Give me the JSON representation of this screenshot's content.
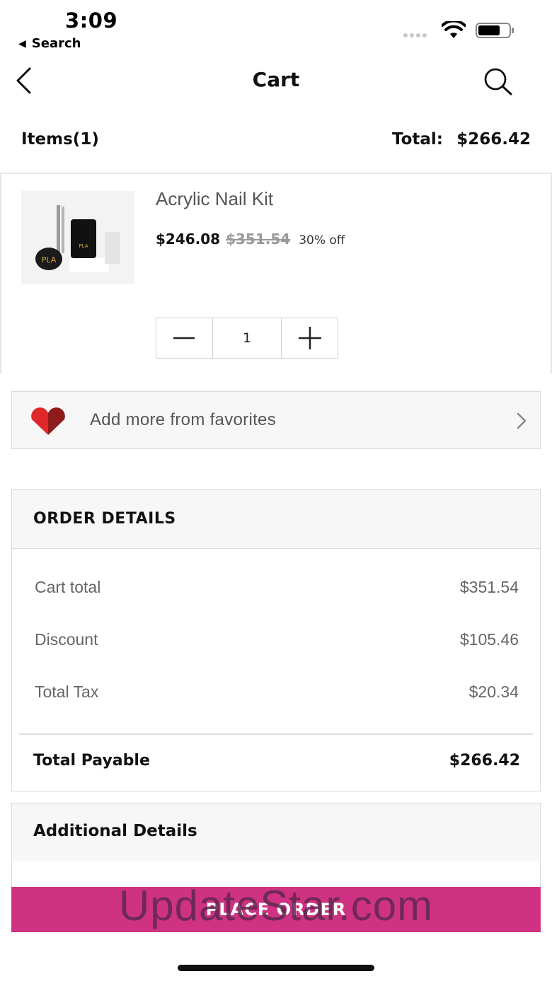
{
  "status_bar": {
    "time": "3:09",
    "back_app": "Search",
    "icons": [
      "signal-dots-icon",
      "wifi-icon",
      "battery-icon"
    ]
  },
  "nav": {
    "title": "Cart",
    "back_icon": "chevron-left-icon",
    "search_icon": "search-icon"
  },
  "summary": {
    "items_label": "Items(1)",
    "total_label": "Total:",
    "total_value": "$266.42"
  },
  "cart_items": [
    {
      "name": "Acrylic Nail Kit",
      "price": "$246.08",
      "original_price": "$351.54",
      "discount": "30% off",
      "quantity": "1",
      "image_text": "PLA"
    }
  ],
  "favorites": {
    "label": "Add more from favorites",
    "icon": "heart-icon",
    "chevron": "chevron-right-icon"
  },
  "order_details": {
    "title": "ORDER DETAILS",
    "rows": [
      {
        "label": "Cart total",
        "value": "$351.54"
      },
      {
        "label": "Discount",
        "value": "$105.46"
      },
      {
        "label": "Total Tax",
        "value": "$20.34"
      }
    ],
    "total_label": "Total Payable",
    "total_value": "$266.42"
  },
  "additional_details": {
    "title": "Additional Details"
  },
  "place_order": {
    "label": "PLACE ORDER",
    "color": "#cf3282"
  },
  "watermark": "UpdateStar.com"
}
